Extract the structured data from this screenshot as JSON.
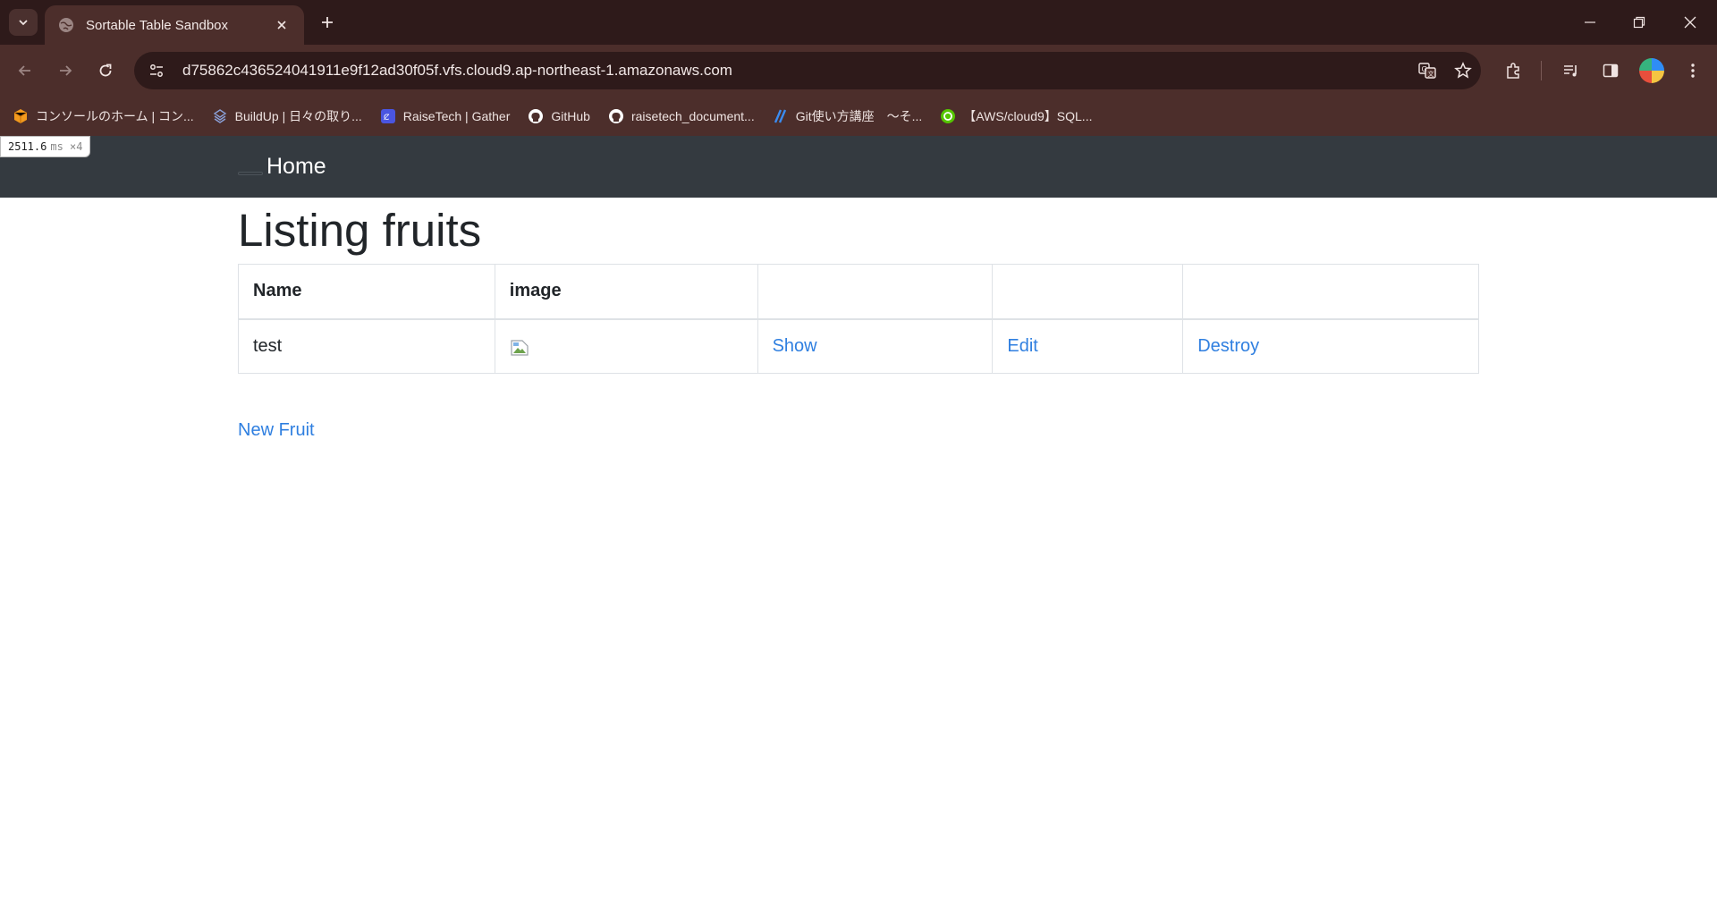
{
  "browser": {
    "tab_title": "Sortable Table Sandbox",
    "url": "d75862c436524041911e9f12ad30f05f.vfs.cloud9.ap-northeast-1.amazonaws.com",
    "bookmarks": [
      {
        "label": "コンソールのホーム | コン...",
        "icon": "aws-cube-icon",
        "color": "#f29a1e"
      },
      {
        "label": "BuildUp | 日々の取り...",
        "icon": "buildup-icon",
        "color": "#8aa0d8"
      },
      {
        "label": "RaiseTech | Gather",
        "icon": "gather-icon",
        "color": "#4a55e0"
      },
      {
        "label": "GitHub",
        "icon": "github-icon",
        "color": "#ffffff"
      },
      {
        "label": "raisetech_document...",
        "icon": "github-icon",
        "color": "#ffffff"
      },
      {
        "label": "Git使い方講座　～そ...",
        "icon": "git-course-icon",
        "color": "#3b8cf0"
      },
      {
        "label": "【AWS/cloud9】SQL...",
        "icon": "qiita-icon",
        "color": "#55c500"
      }
    ]
  },
  "perf": {
    "value": "2511.6",
    "unit": "ms ×4"
  },
  "nav": {
    "brand": "Home"
  },
  "main": {
    "heading": "Listing fruits",
    "table": {
      "headers": [
        "Name",
        "image",
        "",
        "",
        ""
      ],
      "rows": [
        {
          "name": "test",
          "show": "Show",
          "edit": "Edit",
          "destroy": "Destroy"
        }
      ]
    },
    "new_link": "New Fruit"
  },
  "colors": {
    "link": "#2f7fe0",
    "navbar": "#343a40",
    "chrome_dark": "#2e1a1a",
    "chrome": "#4c2e2b"
  }
}
